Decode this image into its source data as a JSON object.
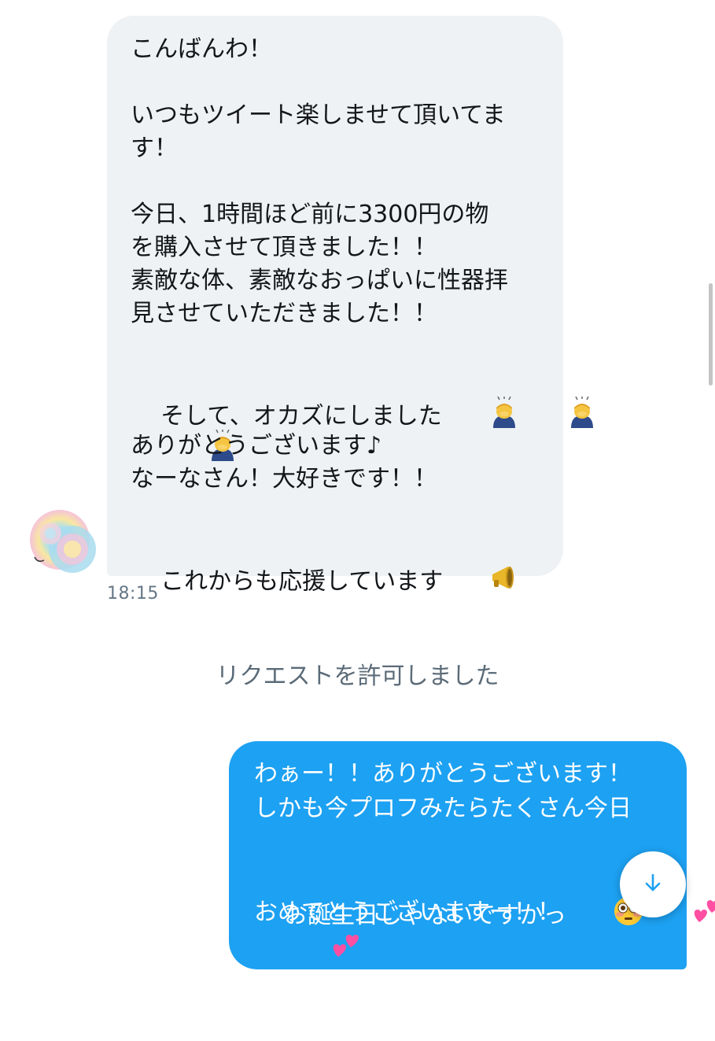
{
  "conversation": {
    "received_message": {
      "lines": [
        "こんばんわ！",
        "",
        "いつもツイート楽しませて頂いてま",
        "す！",
        "",
        "今日、1時間ほど前に3300円の物",
        "を購入させて頂きました！！",
        "素敵な体、素敵なおっぱいに性器拝",
        "見させていただきました！！",
        "そして、オカズにしました",
        "",
        "",
        "ありがとうございます♪",
        "なーなさん！大好きです！！",
        "これからも応援しています"
      ],
      "emojis": {
        "bowing": "person-bowing-emoji",
        "megaphone": "megaphone-emoji"
      },
      "timestamp": "18:15"
    },
    "system_notice": "リクエストを許可しました",
    "sent_message": {
      "lines": [
        "わぁー！！ありがとうございます！",
        "しかも今プロフみたらたくさん今日",
        "お誕生日じゃないですかっ",
        "",
        "おめでとうございますー！！"
      ],
      "emojis": {
        "flushed": "flushed-face-emoji",
        "hearts": "two-hearts-emoji"
      }
    }
  },
  "colors": {
    "received_bubble": "#eef2f4",
    "sent_bubble": "#1da1f2",
    "accent": "#1da1f2",
    "timestamp": "#657786"
  },
  "icons": {
    "scroll_down": "arrow-down-icon",
    "avatar": "avatar"
  }
}
